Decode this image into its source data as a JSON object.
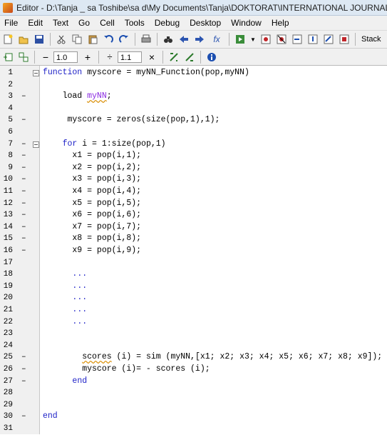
{
  "window": {
    "title": "Editor - D:\\Tanja _ sa Toshibe\\sa d\\My Documents\\Tanja\\DOKTORAT\\INTERNATIONAL JOURNALS\\SCI _MOJI RA"
  },
  "menu": [
    "File",
    "Edit",
    "Text",
    "Go",
    "Cell",
    "Tools",
    "Debug",
    "Desktop",
    "Window",
    "Help"
  ],
  "toolbar": {
    "stack_label": "Stack",
    "fx": "fx"
  },
  "cell_toolbar": {
    "minus": "−",
    "value1": "1.0",
    "plus": "+",
    "divide": "÷",
    "value2": "1.1",
    "times": "×"
  },
  "editor": {
    "lines": [
      {
        "n": "1",
        "dash": "",
        "fold": true,
        "parts": [
          {
            "t": "function",
            "c": "kw"
          },
          {
            "t": " myscore = myNN_Function(pop,myNN)"
          }
        ]
      },
      {
        "n": "2",
        "dash": "",
        "parts": []
      },
      {
        "n": "3",
        "dash": "–",
        "parts": [
          {
            "t": "    load "
          },
          {
            "t": "myNN",
            "c": "purple ul"
          },
          {
            "t": ";"
          }
        ]
      },
      {
        "n": "4",
        "dash": "",
        "parts": []
      },
      {
        "n": "5",
        "dash": "–",
        "parts": [
          {
            "t": "     myscore = zeros(size(pop,1),1);"
          }
        ]
      },
      {
        "n": "6",
        "dash": "",
        "parts": []
      },
      {
        "n": "7",
        "dash": "–",
        "fold": true,
        "parts": [
          {
            "t": "    "
          },
          {
            "t": "for",
            "c": "kw"
          },
          {
            "t": " i = 1:size(pop,1)"
          }
        ]
      },
      {
        "n": "8",
        "dash": "–",
        "parts": [
          {
            "t": "      x1 = pop(i,1);"
          }
        ]
      },
      {
        "n": "9",
        "dash": "–",
        "parts": [
          {
            "t": "      x2 = pop(i,2);"
          }
        ]
      },
      {
        "n": "10",
        "dash": "–",
        "parts": [
          {
            "t": "      x3 = pop(i,3);"
          }
        ]
      },
      {
        "n": "11",
        "dash": "–",
        "parts": [
          {
            "t": "      x4 = pop(i,4);"
          }
        ]
      },
      {
        "n": "12",
        "dash": "–",
        "parts": [
          {
            "t": "      x5 = pop(i,5);"
          }
        ]
      },
      {
        "n": "13",
        "dash": "–",
        "parts": [
          {
            "t": "      x6 = pop(i,6);"
          }
        ]
      },
      {
        "n": "14",
        "dash": "–",
        "parts": [
          {
            "t": "      x7 = pop(i,7);"
          }
        ]
      },
      {
        "n": "15",
        "dash": "–",
        "parts": [
          {
            "t": "      x8 = pop(i,8);"
          }
        ]
      },
      {
        "n": "16",
        "dash": "–",
        "parts": [
          {
            "t": "      x9 = pop(i,9);"
          }
        ]
      },
      {
        "n": "17",
        "dash": "",
        "parts": []
      },
      {
        "n": "18",
        "dash": "",
        "parts": [
          {
            "t": "      "
          },
          {
            "t": "...",
            "c": "kw"
          }
        ]
      },
      {
        "n": "19",
        "dash": "",
        "parts": [
          {
            "t": "      "
          },
          {
            "t": "...",
            "c": "kw"
          }
        ]
      },
      {
        "n": "20",
        "dash": "",
        "parts": [
          {
            "t": "      "
          },
          {
            "t": "...",
            "c": "kw"
          }
        ]
      },
      {
        "n": "21",
        "dash": "",
        "parts": [
          {
            "t": "      "
          },
          {
            "t": "...",
            "c": "kw"
          }
        ]
      },
      {
        "n": "22",
        "dash": "",
        "parts": [
          {
            "t": "      "
          },
          {
            "t": "...",
            "c": "kw"
          }
        ]
      },
      {
        "n": "23",
        "dash": "",
        "parts": []
      },
      {
        "n": "24",
        "dash": "",
        "parts": []
      },
      {
        "n": "25",
        "dash": "–",
        "parts": [
          {
            "t": "        "
          },
          {
            "t": "scores",
            "c": "ul"
          },
          {
            "t": " (i) = sim (myNN,[x1; x2; x3; x4; x5; x6; x7; x8; x9]);"
          }
        ]
      },
      {
        "n": "26",
        "dash": "–",
        "parts": [
          {
            "t": "        myscore (i)= - scores (i);"
          }
        ]
      },
      {
        "n": "27",
        "dash": "–",
        "parts": [
          {
            "t": "      "
          },
          {
            "t": "end",
            "c": "kw"
          }
        ]
      },
      {
        "n": "28",
        "dash": "",
        "parts": []
      },
      {
        "n": "29",
        "dash": "",
        "parts": []
      },
      {
        "n": "30",
        "dash": "–",
        "parts": [
          {
            "t": "end",
            "c": "kw"
          }
        ]
      },
      {
        "n": "31",
        "dash": "",
        "parts": []
      }
    ]
  }
}
